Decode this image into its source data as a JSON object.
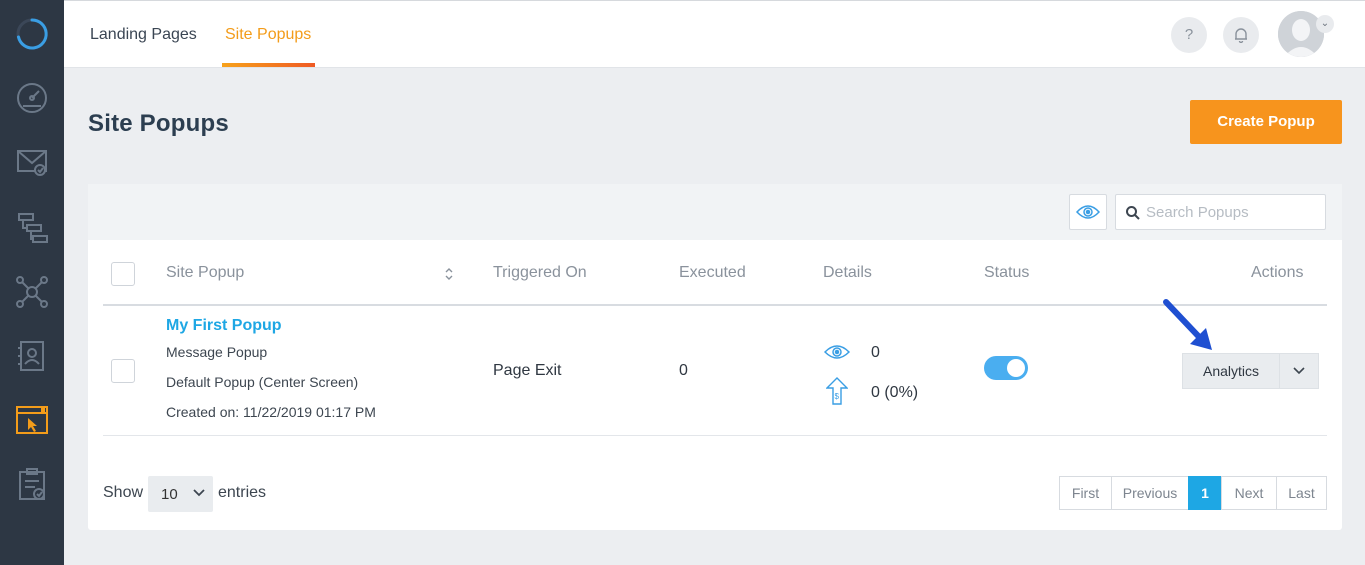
{
  "nav": {
    "tabs": [
      {
        "label": "Landing Pages",
        "active": false
      },
      {
        "label": "Site Popups",
        "active": true
      }
    ],
    "help_label": "?",
    "accent_color": "#f39c1a"
  },
  "sidebar": {
    "icons": [
      "loading-ring-icon",
      "dashboard-gauge-icon",
      "email-icon",
      "workflow-icon",
      "network-icon",
      "contacts-icon",
      "site-popup-icon",
      "tasks-clipboard-icon"
    ],
    "active_icon": "site-popup-icon"
  },
  "page": {
    "title": "Site Popups",
    "create_button": "Create Popup"
  },
  "search": {
    "placeholder": "Search Popups"
  },
  "table": {
    "headers": {
      "site_popup": "Site Popup",
      "triggered_on": "Triggered On",
      "executed": "Executed",
      "details": "Details",
      "status": "Status",
      "actions": "Actions"
    },
    "rows": [
      {
        "name": "My First Popup",
        "type": "Message Popup",
        "position": "Default Popup (Center Screen)",
        "created": "Created on: 11/22/2019 01:17 PM",
        "triggered_on": "Page Exit",
        "executed": "0",
        "views": "0",
        "conversions": "0 (0%)",
        "status_on": true,
        "action_label": "Analytics"
      }
    ]
  },
  "pagination": {
    "show_label": "Show",
    "entries_value": "10",
    "entries_label": "entries",
    "first": "First",
    "previous": "Previous",
    "current": "1",
    "next": "Next",
    "last": "Last"
  }
}
